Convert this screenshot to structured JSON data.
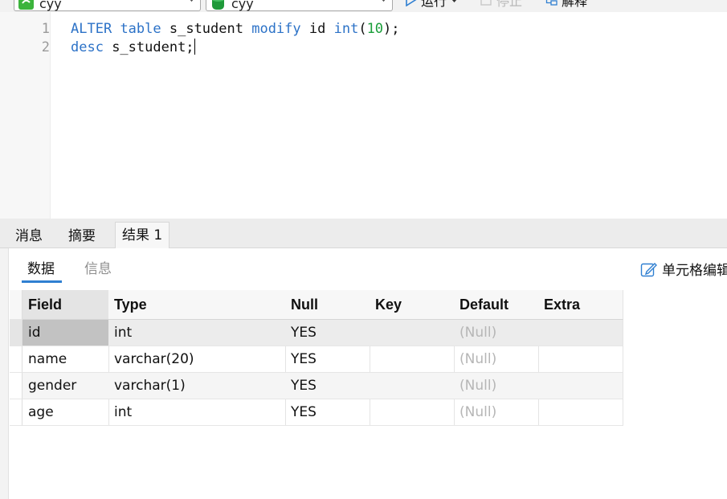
{
  "toolbar": {
    "connection_value": "cyy",
    "database_value": "cyy",
    "run_label": "运行",
    "stop_label": "停止",
    "explain_label": "解释"
  },
  "editor": {
    "line_numbers": [
      "1",
      "2"
    ]
  },
  "bottom_tabs": [
    "消息",
    "摘要",
    "结果 1"
  ],
  "result": {
    "subtabs": [
      "数据",
      "信息"
    ],
    "cell_edit_label": "单元格编辑",
    "columns": [
      "Field",
      "Type",
      "Null",
      "Key",
      "Default",
      "Extra"
    ],
    "rows": [
      [
        "id",
        "int",
        "YES",
        "",
        "(Null)",
        ""
      ],
      [
        "name",
        "varchar(20)",
        "YES",
        "",
        "(Null)",
        ""
      ],
      [
        "gender",
        "varchar(1)",
        "YES",
        "",
        "(Null)",
        ""
      ],
      [
        "age",
        "int",
        "YES",
        "",
        "(Null)",
        ""
      ]
    ]
  },
  "colors": {
    "keyword": "#2c72c7",
    "number": "#1a9e3a",
    "accent": "#2f7fd1"
  }
}
